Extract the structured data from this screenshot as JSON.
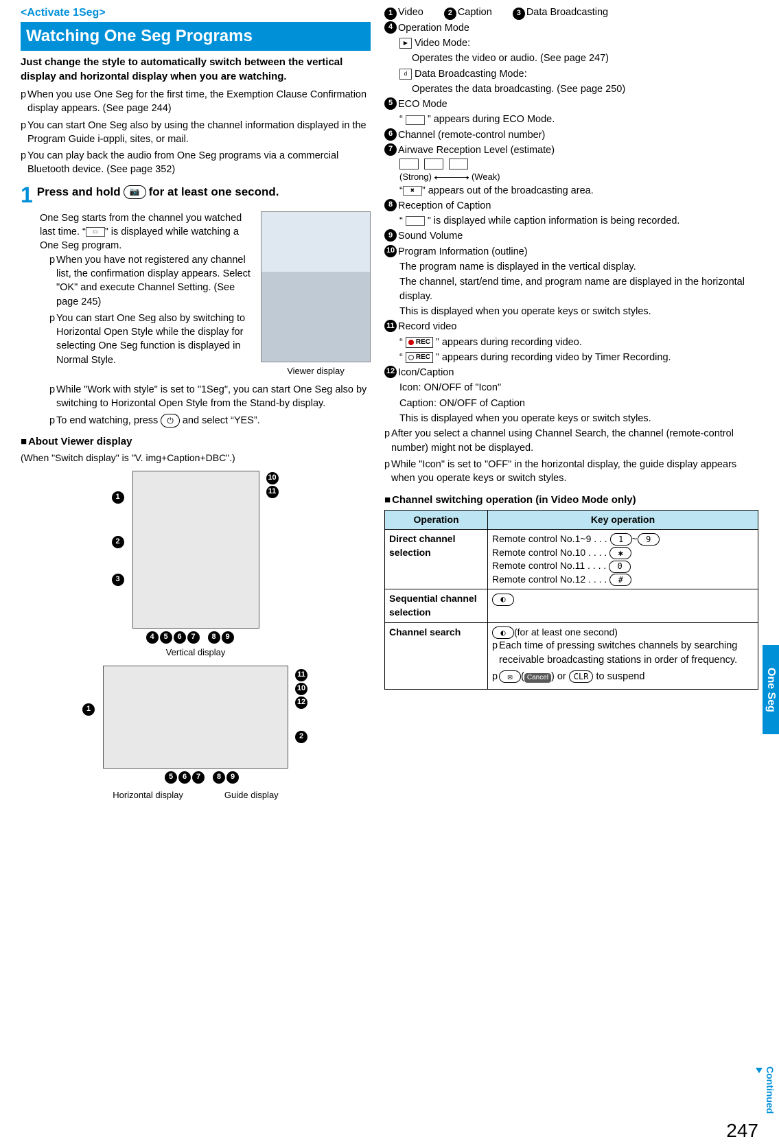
{
  "header": {
    "activate_tag": "<Activate 1Seg>",
    "title": "Watching One Seg Programs"
  },
  "intro": "Just change the style to automatically switch between the vertical display and horizontal display when you are watching.",
  "intro_bullets": [
    "When you use One Seg for the first time, the Exemption Clause Confirmation display appears. (See page 244)",
    "You can start One Seg also by using the channel information displayed in the Program Guide i-αppli, sites, or mail.",
    "You can play back the audio from One Seg programs via a commercial Bluetooth device. (See page 352)"
  ],
  "step": {
    "number": "1",
    "head_before": "Press and hold",
    "head_key": "c",
    "head_after": "for at least one second.",
    "body_text": "One Seg starts from the channel you watched last time. \" \" is displayed while watching a One Seg program.",
    "phone_caption": "Viewer display",
    "sub_bullets": [
      "When you have not registered any channel list, the confirmation display appears. Select \"OK\" and execute Channel Setting. (See page 245)",
      "You can start One Seg also by switching to Horizontal Open Style while the display for selecting One Seg function is displayed in Normal Style.",
      "While \"Work with style\" is set to \"1Seg\", you can start One Seg also by switching to Horizontal Open Style from the Stand-by display.",
      "To end watching, press h and select \"YES\"."
    ]
  },
  "viewer_section": {
    "heading": "About Viewer display",
    "paren": "(When \"Switch display\" is \"V. img+Caption+DBC\".)",
    "vertical_label": "Vertical display",
    "horizontal_label": "Horizontal display",
    "guide_label": "Guide display"
  },
  "right_defs": {
    "row1": [
      "Video",
      "Caption",
      "Data Broadcasting"
    ],
    "items": [
      {
        "n": "4",
        "label": "Operation Mode",
        "lines": [
          {
            "icon": "v",
            "text": "Video Mode:"
          },
          {
            "indent": true,
            "text": "Operates the video or audio. (See page 247)"
          },
          {
            "icon": "d",
            "text": "Data Broadcasting Mode:"
          },
          {
            "indent": true,
            "text": "Operates the data broadcasting. (See page 250)"
          }
        ]
      },
      {
        "n": "5",
        "label": "ECO Mode",
        "lines": [
          {
            "quoted_icon": true,
            "text": "appears during ECO Mode."
          }
        ]
      },
      {
        "n": "6",
        "label": "Channel (remote-control number)"
      },
      {
        "n": "7",
        "label": "Airwave Reception Level (estimate)",
        "signal": true,
        "strong": "(Strong)",
        "weak": "(Weak)",
        "extra": "\" \" appears out of the broadcasting area."
      },
      {
        "n": "8",
        "label": "Reception of Caption",
        "lines": [
          {
            "quoted_icon": true,
            "text": "is displayed while caption information is being recorded."
          }
        ]
      },
      {
        "n": "9",
        "label": "Sound Volume"
      },
      {
        "n": "10",
        "label": "Program Information (outline)",
        "lines": [
          {
            "text": "The program name is displayed in the vertical display."
          },
          {
            "text": "The channel, start/end time, and program name are displayed in the horizontal display."
          },
          {
            "text": "This is displayed when you operate keys or switch styles."
          }
        ]
      },
      {
        "n": "11",
        "label": "Record video",
        "lines": [
          {
            "rec": "red",
            "text": "appears during recording video."
          },
          {
            "rec": "clock",
            "text": "appears during recording video by Timer Recording."
          }
        ]
      },
      {
        "n": "12",
        "label": "Icon/Caption",
        "lines": [
          {
            "text": "Icon: ON/OFF of \"Icon\""
          },
          {
            "text": "Caption: ON/OFF of Caption"
          },
          {
            "text": "This is displayed when you operate keys or switch styles."
          }
        ]
      }
    ],
    "after_bullets": [
      "After you select a channel using Channel Search, the channel (remote-control number) might not be displayed.",
      "While \"Icon\" is set to \"OFF\" in the horizontal display, the guide display appears when you operate keys or switch styles."
    ]
  },
  "table": {
    "heading": "Channel switching operation (in Video Mode only)",
    "headers": [
      "Operation",
      "Key operation"
    ],
    "rows": [
      {
        "op": "Direct channel selection",
        "keylines": [
          {
            "pre": "Remote control No.1~9 . . .",
            "keys": [
              "1",
              "9"
            ],
            "sep": "~"
          },
          {
            "pre": "Remote control No.10 . . . .",
            "keys": [
              "✱"
            ]
          },
          {
            "pre": "Remote control No.11 . . . .",
            "keys": [
              "0"
            ]
          },
          {
            "pre": "Remote control No.12 . . . .",
            "keys": [
              "#"
            ]
          }
        ]
      },
      {
        "op": "Sequential channel selection",
        "keylines": [
          {
            "keys": [
              "No"
            ]
          }
        ]
      },
      {
        "op": "Channel search",
        "keylines_raw": true,
        "first_line_key": "No",
        "first_line_suffix": "(for at least one second)",
        "bullets": [
          "Each time of pressing switches channels by searching receivable broadcasting stations in order of frequency.",
          "l( ) or r to suspend"
        ],
        "cancel_label": "Cancel",
        "clr_label": "CLR",
        "mail_key": "l"
      }
    ]
  },
  "side_tab": "One Seg",
  "continued": "Continued",
  "page_number": "247"
}
